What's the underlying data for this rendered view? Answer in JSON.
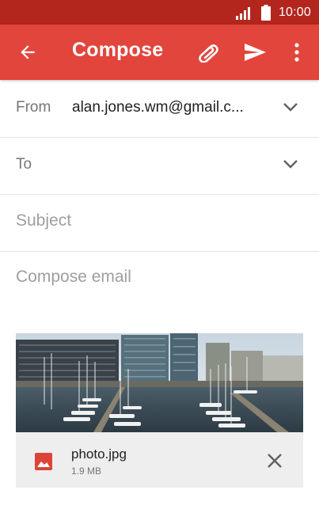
{
  "status_bar": {
    "time": "10:00",
    "signal_icon": "signal-icon",
    "battery_icon": "battery-icon"
  },
  "app_bar": {
    "title": "Compose",
    "back_icon": "arrow-back-icon",
    "attach_icon": "paperclip-icon",
    "send_icon": "send-icon",
    "more_icon": "more-vert-icon",
    "color": "#e2453c",
    "status_color": "#b3261e"
  },
  "form": {
    "from_label": "From",
    "from_value": "alan.jones.wm@gmail.c...",
    "to_label": "To",
    "subject_placeholder": "Subject",
    "body_placeholder": "Compose email"
  },
  "attachment": {
    "file_name": "photo.jpg",
    "file_size": "1.9 MB",
    "file_icon": "image-icon",
    "remove_icon": "close-icon"
  }
}
